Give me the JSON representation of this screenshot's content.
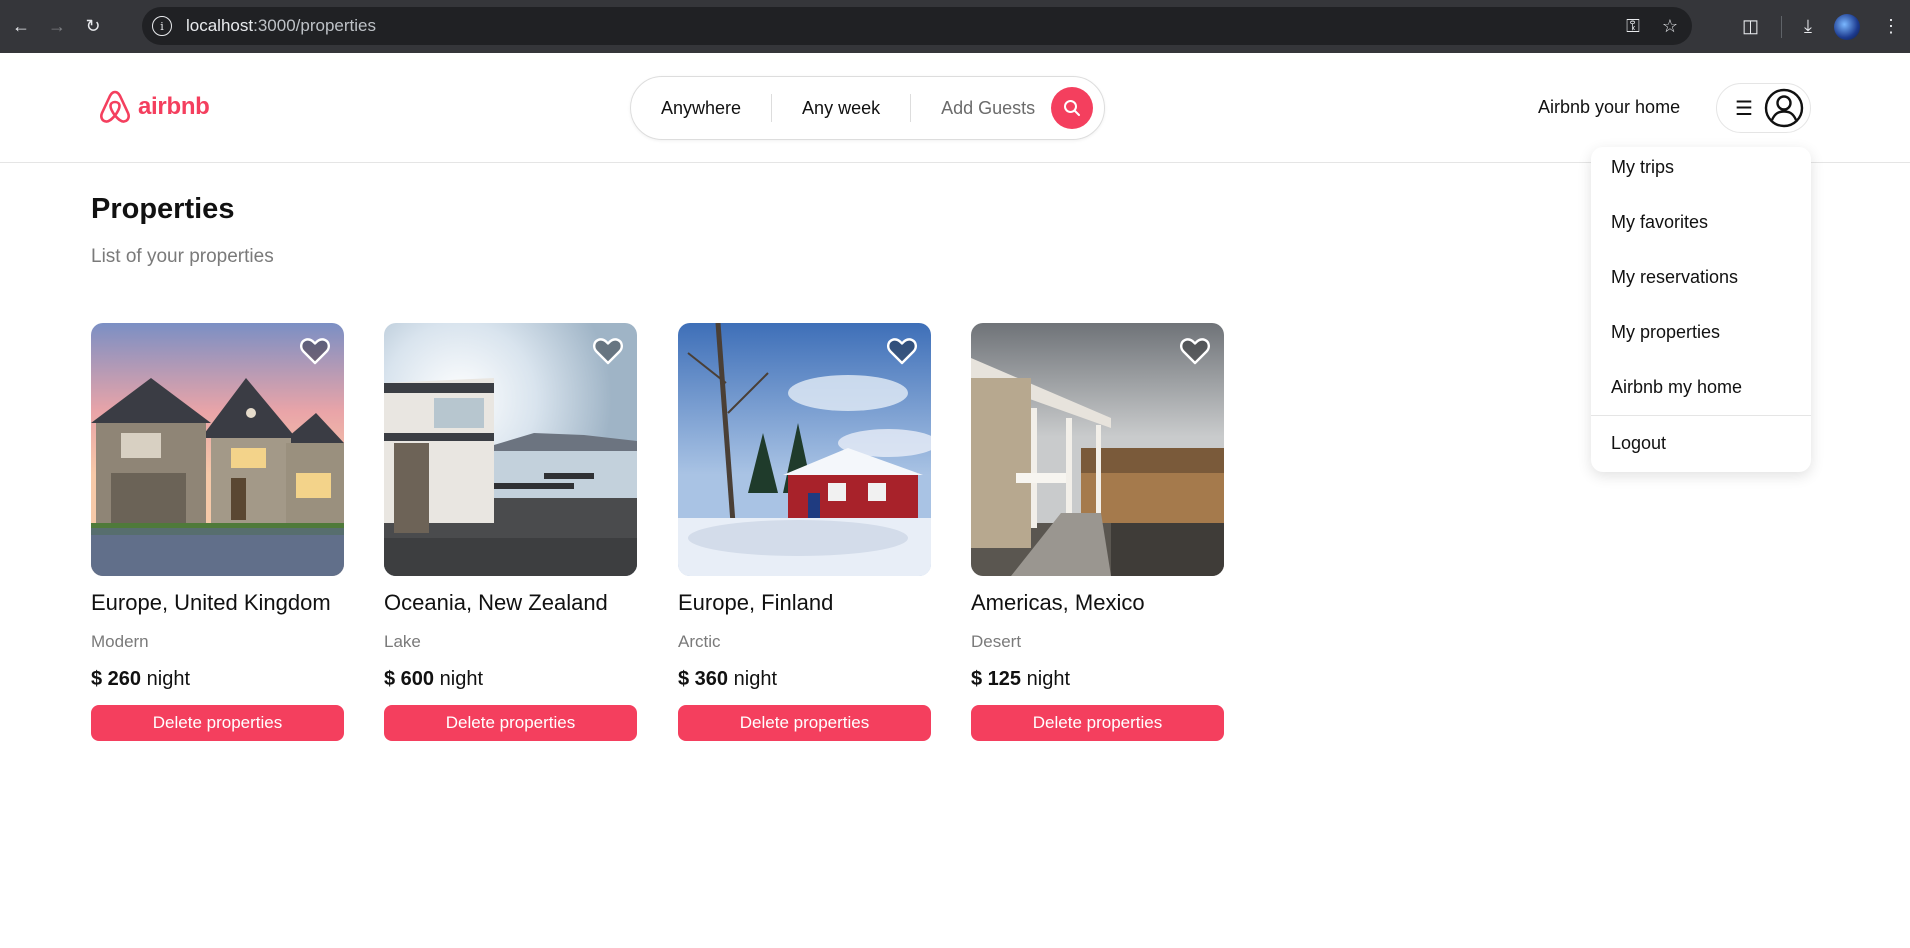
{
  "browser": {
    "url_host": "localhost",
    "url_path": ":3000/properties"
  },
  "header": {
    "logo_text": "airbnb",
    "search": {
      "location": "Anywhere",
      "week": "Any week",
      "guests": "Add Guests"
    },
    "host_link": "Airbnb your home"
  },
  "menu": {
    "items": [
      "My trips",
      "My favorites",
      "My reservations",
      "My properties",
      "Airbnb my home"
    ],
    "logout": "Logout"
  },
  "page": {
    "title": "Properties",
    "subtitle": "List of your properties"
  },
  "listings": [
    {
      "location": "Europe, United Kingdom",
      "category": "Modern",
      "price": "$ 260",
      "unit": "night",
      "action": "Delete properties"
    },
    {
      "location": "Oceania, New Zealand",
      "category": "Lake",
      "price": "$ 600",
      "unit": "night",
      "action": "Delete properties"
    },
    {
      "location": "Europe, Finland",
      "category": "Arctic",
      "price": "$ 360",
      "unit": "night",
      "action": "Delete properties"
    },
    {
      "location": "Americas, Mexico",
      "category": "Desert",
      "price": "$ 125",
      "unit": "night",
      "action": "Delete properties"
    }
  ],
  "colors": {
    "brand": "#f43f5e",
    "chrome": "#35363a"
  }
}
